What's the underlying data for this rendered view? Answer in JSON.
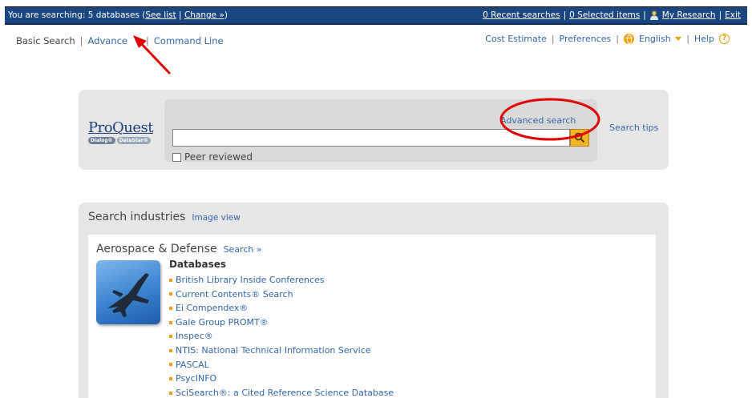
{
  "topbar": {
    "searching_text": "You are searching: 5 databases (",
    "see_list": "See list",
    "sep1": " | ",
    "change": "Change »",
    "close_paren": ")",
    "recent_searches": "0 Recent searches",
    "sep2": "|",
    "selected_items": "0 Selected items",
    "sep3": "|",
    "my_research": "My Research",
    "sep4": "|",
    "exit": "Exit"
  },
  "subnav": {
    "basic": "Basic Search",
    "sep": "|",
    "advanced": "Advance",
    "command_line": "Command Line"
  },
  "utilnav": {
    "cost_estimate": "Cost Estimate",
    "sep": "|",
    "preferences": "Preferences",
    "language": "English",
    "help": "Help",
    "help_glyph": "?"
  },
  "search": {
    "logo_main": "ProQuest",
    "logo_dialog": "Dialog®",
    "logo_datastar": "DataStar®",
    "advanced_link": "Advanced search",
    "input_value": "",
    "peer_reviewed": "Peer reviewed",
    "search_tips": "Search tips"
  },
  "industries": {
    "title": "Search industries",
    "image_view": "Image view",
    "industry_name": "Aerospace & Defense",
    "search_link": "Search »",
    "databases_heading": "Databases",
    "databases": [
      "British Library Inside Conferences",
      "Current Contents® Search",
      "Ei Compendex®",
      "Gale Group PROMT®",
      "Inspec®",
      "NTIS: National Technical Information Service",
      "PASCAL",
      "PsycINFO",
      "SciSearch®: a Cited Reference Science Database"
    ]
  },
  "colors": {
    "topbar_bg": "#1a4780",
    "link": "#3366aa",
    "accent": "#f2a100",
    "annotation": "#e00000"
  }
}
